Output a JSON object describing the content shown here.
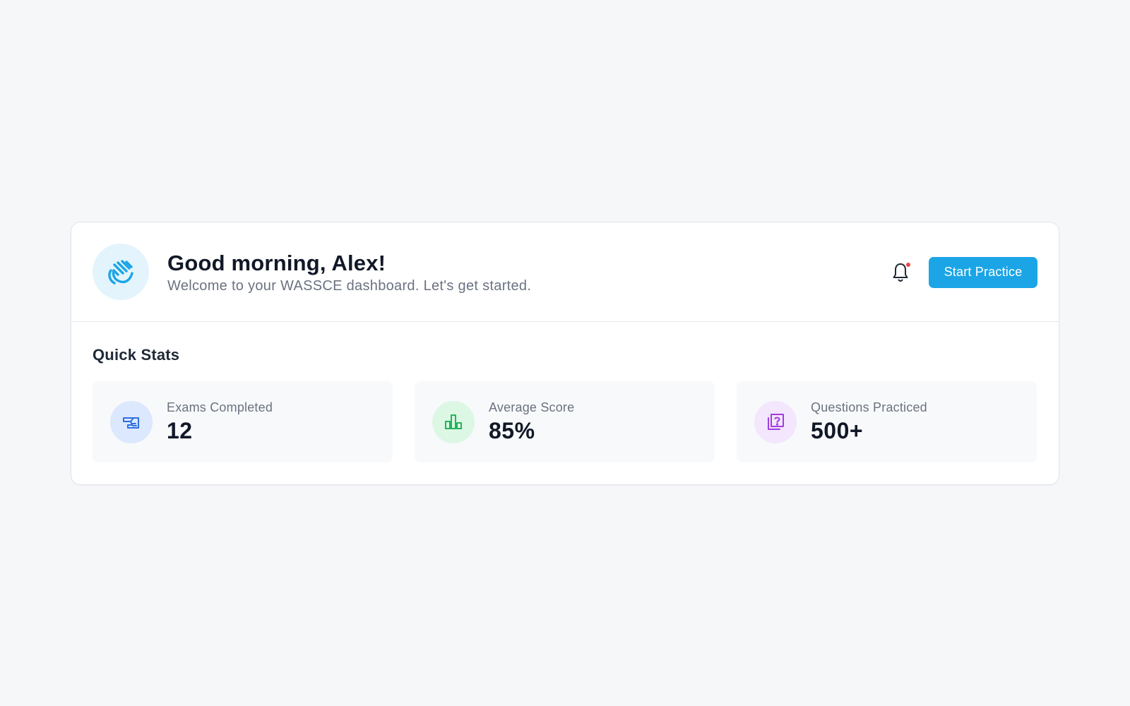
{
  "header": {
    "greeting": "Good morning, Alex!",
    "subtitle": "Welcome to your WASSCE dashboard. Let's get started.",
    "avatar_icon": "waving-hand-icon",
    "notification_icon": "bell-icon",
    "has_unread_notifications": true,
    "start_button_label": "Start Practice"
  },
  "quick_stats": {
    "title": "Quick Stats",
    "items": [
      {
        "label": "Exams Completed",
        "value": "12",
        "icon": "graduation-cap-icon",
        "icon_color": "#2f6fe0",
        "icon_bg": "#dbe8fd"
      },
      {
        "label": "Average Score",
        "value": "85%",
        "icon": "bar-chart-icon",
        "icon_color": "#22b45a",
        "icon_bg": "#dcf7e4"
      },
      {
        "label": "Questions Practiced",
        "value": "500+",
        "icon": "question-stack-icon",
        "icon_color": "#a03ee0",
        "icon_bg": "#f3e6fd"
      }
    ]
  },
  "colors": {
    "accent": "#1ba5e6",
    "notification_dot": "#ef4444",
    "background": "#f6f7f9"
  }
}
